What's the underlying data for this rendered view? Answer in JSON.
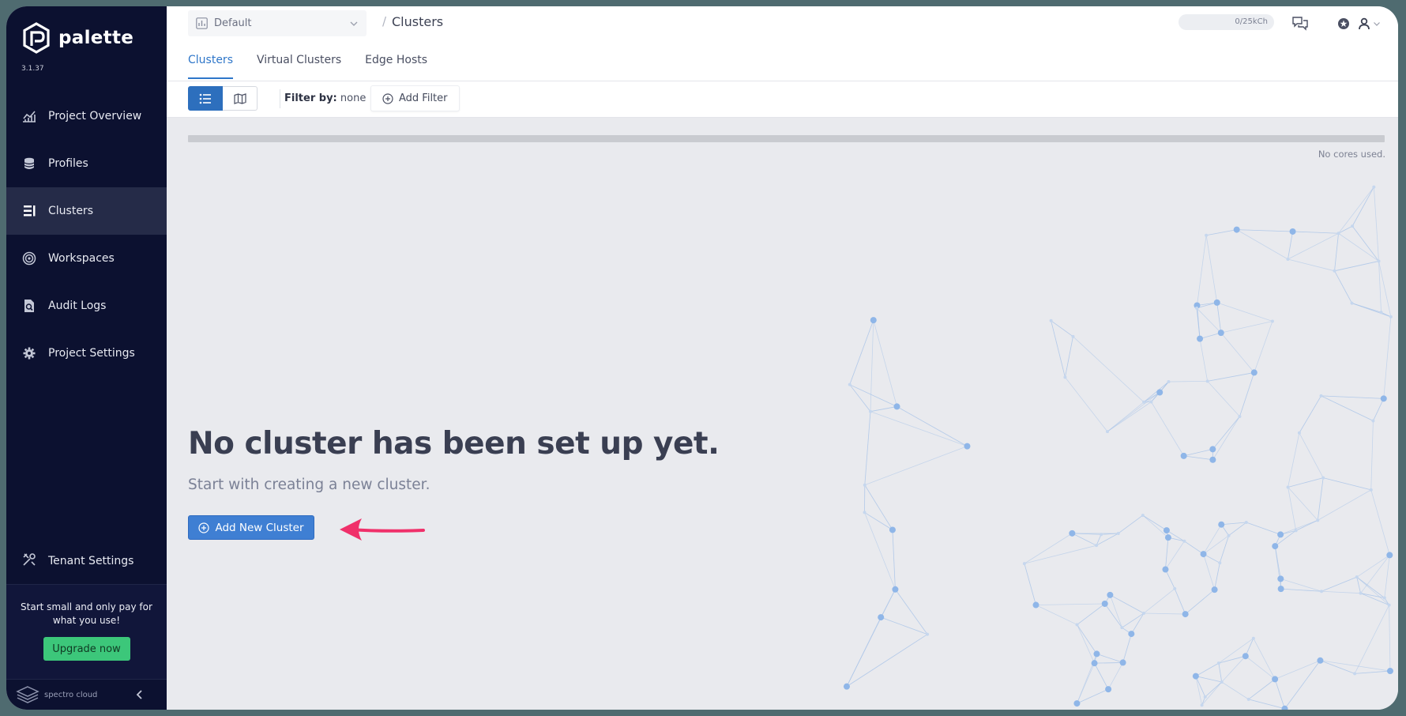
{
  "sidebar": {
    "logo_text": "palette",
    "version": "3.1.37",
    "items": [
      {
        "label": "Project Overview",
        "icon": "chart-icon"
      },
      {
        "label": "Profiles",
        "icon": "database-icon"
      },
      {
        "label": "Clusters",
        "icon": "clusters-icon",
        "active": true
      },
      {
        "label": "Workspaces",
        "icon": "workspaces-icon"
      },
      {
        "label": "Audit Logs",
        "icon": "audit-icon"
      },
      {
        "label": "Project Settings",
        "icon": "gear-icon"
      }
    ],
    "tenant_settings": "Tenant Settings",
    "promo_text": "Start small and only pay for what you use!",
    "upgrade_label": "Upgrade now",
    "brand": "spectro cloud"
  },
  "header": {
    "project": "Default",
    "breadcrumb_sep": "/",
    "title": "Clusters",
    "usage_pill": "0/25kCh",
    "tabs": [
      {
        "label": "Clusters",
        "active": true
      },
      {
        "label": "Virtual Clusters"
      },
      {
        "label": "Edge Hosts"
      }
    ]
  },
  "filter": {
    "label": "Filter by:",
    "value": "none",
    "add_label": "Add Filter"
  },
  "main": {
    "usage_caption": "No cores used.",
    "usage_fraction": 0,
    "empty_title": "No cluster has been set up yet.",
    "empty_subtitle": "Start with creating a new cluster.",
    "add_button": "Add New Cluster"
  },
  "colors": {
    "sidebar_bg": "#0c1130",
    "accent": "#2e76c9",
    "upgrade": "#3cc77a",
    "arrow": "#f0306a"
  }
}
